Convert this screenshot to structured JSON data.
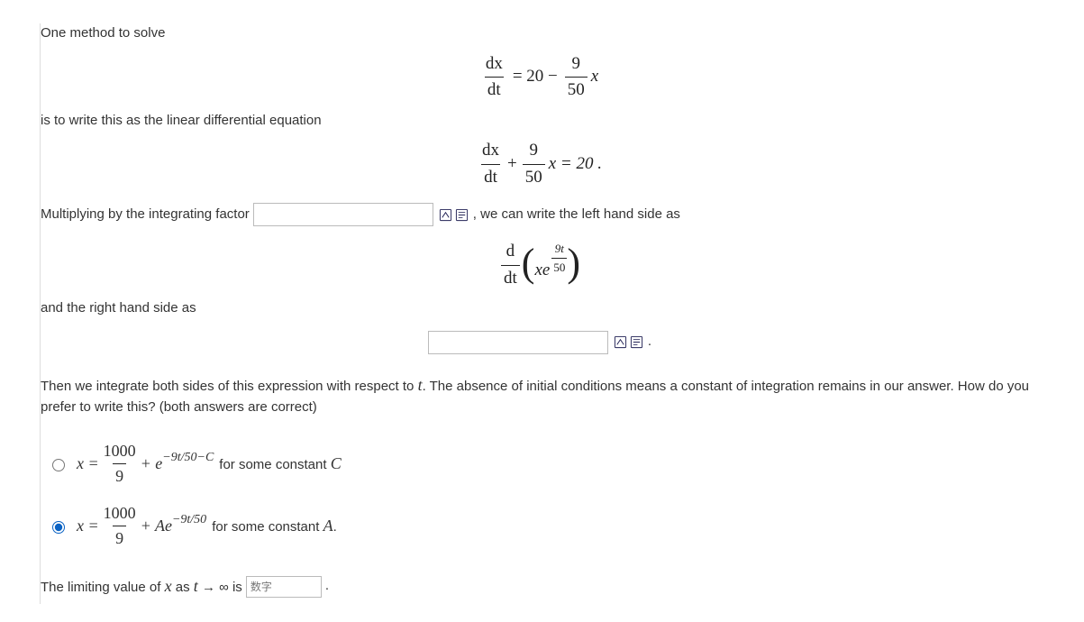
{
  "p1": "One method to solve",
  "eq1": {
    "lhs_num": "dx",
    "lhs_den": "dt",
    "eq": " = 20 − ",
    "rhs_num": "9",
    "rhs_den": "50",
    "var": "x"
  },
  "p2": "is to write this as the linear differential equation",
  "eq2": {
    "lhs_num": "dx",
    "lhs_den": "dt",
    "plus": " + ",
    "mid_num": "9",
    "mid_den": "50",
    "mid_var": "x = 20 ."
  },
  "p3_a": "Multiplying by the integrating factor ",
  "p3_b": ", we can write the left hand side as",
  "eq3": {
    "d_num": "d",
    "d_den": "dt",
    "inner_var": "xe",
    "exp_num": "9t",
    "exp_den": "50"
  },
  "p4": "and the right hand side as",
  "p5": "Then we integrate both sides of this expression with respect to t. The absence of initial conditions means a constant of integration remains in our answer. How do you prefer to write this? (both answers are correct)",
  "opt1": {
    "x": "x = ",
    "fr_num": "1000",
    "fr_den": "9",
    "mid": " + e",
    "exp": "−9t/50−C",
    "suffix": " for some constant C"
  },
  "opt2": {
    "x": "x = ",
    "fr_num": "1000",
    "fr_den": "9",
    "mid": " + Ae",
    "exp": "−9t/50",
    "suffix": " for some constant A."
  },
  "p6_a": "The limiting value of x as t → ∞ is ",
  "p6_b": ".",
  "placeholder_num": "数字",
  "period_after_icons": "."
}
